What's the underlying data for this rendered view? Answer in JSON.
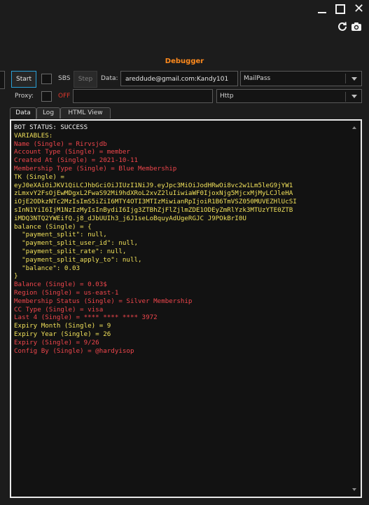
{
  "window": {
    "title": "Debugger"
  },
  "toolbar": {
    "start_label": "Start",
    "sbs_label": "SBS",
    "step_label": "Step",
    "data_label": "Data:",
    "data_value": "areddude@gmail.com:Kandy101",
    "wordlist_type": "MailPass",
    "proxy_label": "Proxy:",
    "proxy_state": "OFF",
    "proxy_value": "",
    "proxy_type": "Http"
  },
  "tabs": [
    {
      "label": "Data",
      "active": true
    },
    {
      "label": "Log",
      "active": false
    },
    {
      "label": "HTML View",
      "active": false
    }
  ],
  "colors": {
    "accent": "#ff8a1c",
    "white": "#f5f5f5",
    "yellow": "#f0e05a",
    "red": "#f0464c",
    "start_border": "#2a9fd6"
  },
  "icons": [
    "minimize-icon",
    "maximize-icon",
    "close-icon",
    "refresh-icon",
    "camera-icon"
  ],
  "output": {
    "lines": [
      {
        "text": "BOT STATUS: SUCCESS",
        "color": "white"
      },
      {
        "text": "VARIABLES:",
        "color": "yellow"
      },
      {
        "text": "Name (Single) = Rirvsjdb",
        "color": "red"
      },
      {
        "text": "Account Type (Single) = member",
        "color": "red"
      },
      {
        "text": "Created At (Single) = 2021-10-11",
        "color": "red"
      },
      {
        "text": "Membership Type (Single) = Blue Membership",
        "color": "red"
      },
      {
        "text": "TK (Single) =",
        "color": "yellow"
      },
      {
        "text": "eyJ0eXAiOiJKV1QiLCJhbGciOiJIUzI1NiJ9.eyJpc3MiOiJodHRwOi8vc2w1Lm5leG9jYW1",
        "color": "yellow"
      },
      {
        "text": "zLmxvY2FsOjEwMDgxL2FwaS92Mi9hdXRoL2xvZ2luIiwiaWF0IjoxNjg5MjcxMjMyLCJleHA",
        "color": "yellow"
      },
      {
        "text": "iOjE2ODkzNTc2MzIsImS5iZiI6MTY4OTI3MTIzMiwianRpIjoiR1B6TmVSZ050MUVEZHlUcSI",
        "color": "yellow"
      },
      {
        "text": "sInN1YiI6IjM1NzIzMyIsInBydiI6Ijg3ZTBhZjFlZjlmZDE1ODEyZmRlYzk3MTUzYTE0ZTB",
        "color": "yellow"
      },
      {
        "text": "iMDQ3NTQ2YWEifQ.j8_dJbUUIh3_j6J1seLoBquyAdUgeRGJC J9POkBrI0U",
        "color": "yellow"
      },
      {
        "text": "balance (Single) = {",
        "color": "yellow"
      },
      {
        "text": "  \"payment_split\": null,",
        "color": "yellow"
      },
      {
        "text": "  \"payment_split_user_id\": null,",
        "color": "yellow"
      },
      {
        "text": "  \"payment_split_rate\": null,",
        "color": "yellow"
      },
      {
        "text": "  \"payment_split_apply_to\": null,",
        "color": "yellow"
      },
      {
        "text": "  \"balance\": 0.03",
        "color": "yellow"
      },
      {
        "text": "}",
        "color": "yellow"
      },
      {
        "text": "Balance (Single) = 0.03$",
        "color": "red"
      },
      {
        "text": "Region (Single) = us-east-1",
        "color": "red"
      },
      {
        "text": "Membership Status (Single) = Silver Membership",
        "color": "red"
      },
      {
        "text": "CC Type (Single) = visa",
        "color": "red"
      },
      {
        "text": "Last 4 (Single) = **** **** **** 3972",
        "color": "red"
      },
      {
        "text": "Expiry Month (Single) = 9",
        "color": "yellow"
      },
      {
        "text": "Expiry Year (Single) = 26",
        "color": "yellow"
      },
      {
        "text": "Expiry (Single) = 9/26",
        "color": "red"
      },
      {
        "text": "Config By (Single) = @hardyisop",
        "color": "red"
      }
    ]
  }
}
